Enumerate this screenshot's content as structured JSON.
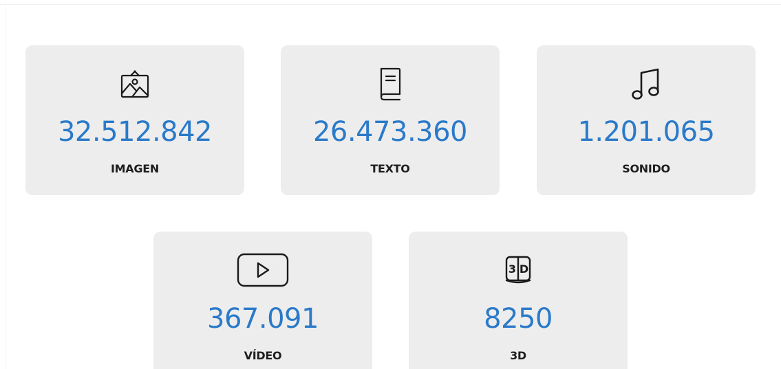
{
  "stats": [
    {
      "value": "32.512.842",
      "label": "IMAGEN",
      "icon": "image-icon"
    },
    {
      "value": "26.473.360",
      "label": "TEXTO",
      "icon": "book-icon"
    },
    {
      "value": "1.201.065",
      "label": "SONIDO",
      "icon": "music-note-icon"
    },
    {
      "value": "367.091",
      "label": "VÍDEO",
      "icon": "play-icon"
    },
    {
      "value": "8250",
      "label": "3D",
      "icon": "3d-cube-icon"
    }
  ],
  "colors": {
    "value_blue": "#2a7ac9",
    "card_background": "#ededed",
    "label_text": "#1e1e1e",
    "icon_stroke": "#1a1a1a"
  }
}
